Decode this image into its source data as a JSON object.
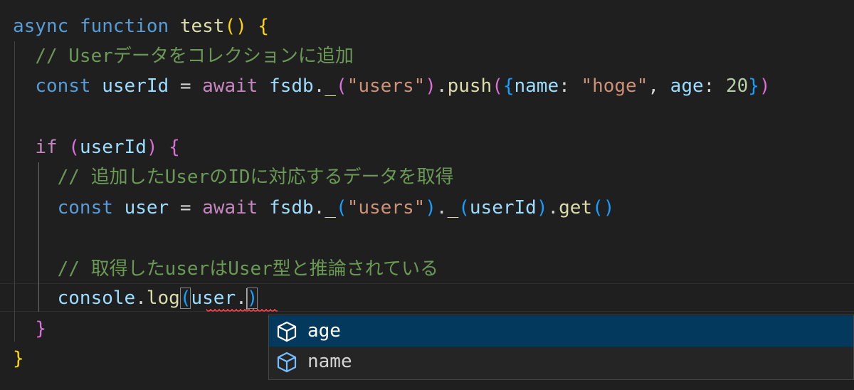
{
  "code": {
    "l1": {
      "kw_async": "async",
      "kw_function": "function",
      "fn_name": "test",
      "paren_open": "(",
      "paren_close": ")",
      "brace_open": "{"
    },
    "l2": {
      "comment": "// Userデータをコレクションに追加"
    },
    "l3": {
      "kw_const": "const",
      "var": "userId",
      "op": "=",
      "kw_await": "await",
      "obj": "fsdb",
      "dot1": ".",
      "method1": "_",
      "p1o": "(",
      "str1": "\"users\"",
      "p1c": ")",
      "dot2": ".",
      "method2": "push",
      "p2o": "(",
      "b_o": "{",
      "key1": "name",
      "colon1": ":",
      "str2": "\"hoge\"",
      "comma": ",",
      "key2": "age",
      "colon2": ":",
      "num": "20",
      "b_c": "}",
      "p2c": ")"
    },
    "l5": {
      "kw_if": "if",
      "p_o": "(",
      "var": "userId",
      "p_c": ")",
      "brace_open": "{"
    },
    "l6": {
      "comment": "// 追加したUserのIDに対応するデータを取得"
    },
    "l7": {
      "kw_const": "const",
      "var": "user",
      "op": "=",
      "kw_await": "await",
      "obj": "fsdb",
      "dot1": ".",
      "method1": "_",
      "p1o": "(",
      "str1": "\"users\"",
      "p1c": ")",
      "dot2": ".",
      "method2": "_",
      "p2o": "(",
      "arg": "userId",
      "p2c": ")",
      "dot3": ".",
      "method3": "get",
      "p3o": "(",
      "p3c": ")"
    },
    "l9": {
      "comment": "// 取得したuserはUser型と推論されている"
    },
    "l10": {
      "obj": "console",
      "dot": ".",
      "method": "log",
      "p_o": "(",
      "arg": "user",
      "dot2": ".",
      "p_c": ")"
    },
    "l11": {
      "brace_close": "}"
    },
    "l12": {
      "brace_close": "}"
    }
  },
  "suggestions": [
    {
      "label": "age",
      "icon": "property-icon",
      "selected": true
    },
    {
      "label": "name",
      "icon": "property-icon",
      "selected": false
    }
  ],
  "colors": {
    "background": "#1f1f1f",
    "keyword": "#569cd6",
    "control": "#c586c0",
    "function": "#dcdcaa",
    "variable": "#9cdcfe",
    "comment": "#6a9955",
    "string": "#ce9178",
    "number": "#b5cea8",
    "suggest_selected": "#04395e",
    "error_squiggle": "#f14c4c"
  }
}
